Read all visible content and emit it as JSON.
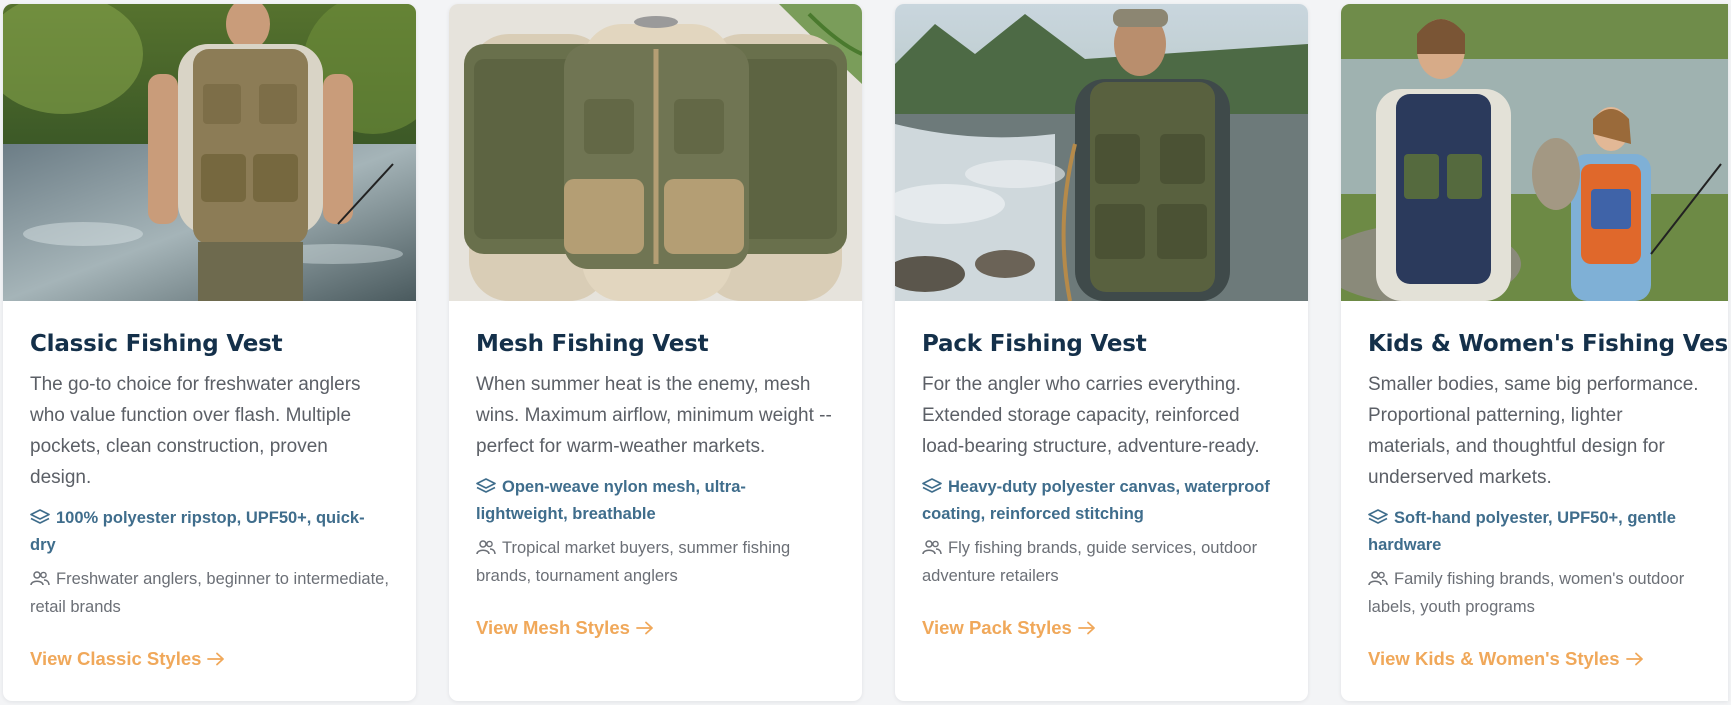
{
  "cards": [
    {
      "title": "Classic Fishing Vest",
      "description": "The go-to choice for freshwater anglers who value function over flash. Multiple pockets, clean construction, proven design.",
      "material": "100% polyester ripstop, UPF50+, quick-dry",
      "audience": "Freshwater anglers, beginner to intermediate, retail brands",
      "link": "View Classic Styles",
      "image_alt": "Man in khaki fishing vest walking in a stream"
    },
    {
      "title": "Mesh Fishing Vest",
      "description": "When summer heat is the enemy, mesh wins. Maximum airflow, minimum weight -- perfect for warm-weather markets.",
      "material": "Open-weave nylon mesh, ultra-lightweight, breathable",
      "audience": "Tropical market buyers, summer fishing brands, tournament anglers",
      "link": "View Mesh Styles",
      "image_alt": "Three mesh fishing vests displayed on mannequins"
    },
    {
      "title": "Pack Fishing Vest",
      "description": "For the angler who carries everything. Extended storage capacity, reinforced load-bearing structure, adventure-ready.",
      "material": "Heavy-duty polyester canvas, waterproof coating, reinforced stitching",
      "audience": "Fly fishing brands, guide services, outdoor adventure retailers",
      "link": "View Pack Styles",
      "image_alt": "Angler wearing a loaded pack fishing vest by a river"
    },
    {
      "title": "Kids & Women's Fishing Vest",
      "description": "Smaller bodies, same big performance. Proportional patterning, lighter materials, and thoughtful design for underserved markets.",
      "material": "Soft-hand polyester, UPF50+, gentle hardware",
      "audience": "Family fishing brands, women's outdoor labels, youth programs",
      "link": "View Kids & Women's Styles",
      "image_alt": "Woman and girl in fishing vests by a lake"
    }
  ],
  "icons": {
    "material": "layers-icon",
    "audience": "users-icon",
    "link": "arrow-right-icon"
  },
  "colors": {
    "title": "#14304a",
    "material": "#3f6d8c",
    "link": "#f0a85a",
    "text": "#5b5f66"
  }
}
